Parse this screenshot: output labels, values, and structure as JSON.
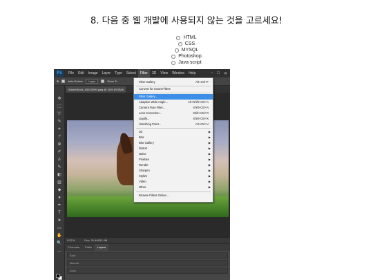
{
  "question": {
    "title": "8. 다음 중 웹 개발에 사용되지 않는 것을 고르세요!",
    "options": [
      "HTML",
      "CSS",
      "MYSQL",
      "Photoshop",
      "Java script"
    ]
  },
  "photoshop": {
    "logo": "Ps",
    "menus": [
      "File",
      "Edit",
      "Image",
      "Layer",
      "Type",
      "Select",
      "Filter",
      "3D",
      "View",
      "Window",
      "Help"
    ],
    "active_menu": "Filter",
    "options_bar": [
      "Auto-Select:",
      "Layer",
      "Show Tr"
    ],
    "document_tab": "AdobeStock_83643096.jpeg @ 16% (RGB/8)",
    "status": {
      "zoom": "5.57%",
      "doc": "Doc: 31.4M/31.4M"
    },
    "panel_tabs": [
      "Channels",
      "Paths",
      "Layers"
    ],
    "active_panel_tab": "Layers",
    "panel_rows": [
      "Kind",
      "Normal",
      "Lock:"
    ],
    "filter_menu": {
      "items": [
        {
          "label": "Filter Gallery",
          "shortcut": "Alt+Ctrl+F"
        },
        {
          "label": "Convert for Smart Filters",
          "shortcut": ""
        },
        {
          "label": "Filter Gallery...",
          "shortcut": ""
        },
        {
          "label": "Adaptive Wide Angle...",
          "shortcut": "Alt+Shift+Ctrl+A"
        },
        {
          "label": "Camera Raw Filter...",
          "shortcut": "Shift+Ctrl+A"
        },
        {
          "label": "Lens Correction...",
          "shortcut": "Shift+Ctrl+R"
        },
        {
          "label": "Liquify...",
          "shortcut": "Shift+Ctrl+X"
        },
        {
          "label": "Vanishing Point...",
          "shortcut": "Alt+Ctrl+V"
        },
        {
          "label": "3D",
          "shortcut": ""
        },
        {
          "label": "Blur",
          "shortcut": ""
        },
        {
          "label": "Blur Gallery",
          "shortcut": ""
        },
        {
          "label": "Distort",
          "shortcut": ""
        },
        {
          "label": "Noise",
          "shortcut": ""
        },
        {
          "label": "Pixelate",
          "shortcut": ""
        },
        {
          "label": "Render",
          "shortcut": ""
        },
        {
          "label": "Sharpen",
          "shortcut": ""
        },
        {
          "label": "Stylize",
          "shortcut": ""
        },
        {
          "label": "Video",
          "shortcut": ""
        },
        {
          "label": "Other",
          "shortcut": ""
        },
        {
          "label": "Browse Filters Online...",
          "shortcut": ""
        }
      ],
      "highlighted": "Filter Gallery..."
    }
  }
}
